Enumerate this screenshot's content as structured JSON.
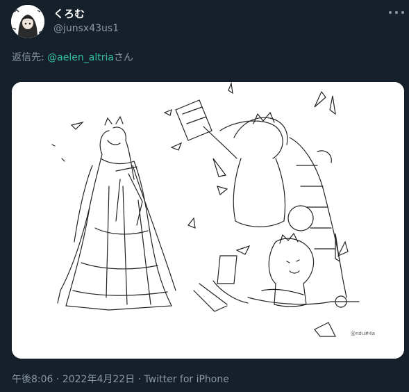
{
  "user": {
    "display_name": "くろむ",
    "handle": "@junsx43us1"
  },
  "reply": {
    "prefix": "返信先: ",
    "mention": "@aelen_altria",
    "suffix": "さん"
  },
  "meta": {
    "time": "午後8:06",
    "separator1": " · ",
    "date": "2022年4月22日",
    "separator2": " · ",
    "source": "Twitter for iPhone"
  },
  "colors": {
    "background": "#15202b",
    "mention": "#33c2a0",
    "secondary_text": "#8b98a5"
  }
}
